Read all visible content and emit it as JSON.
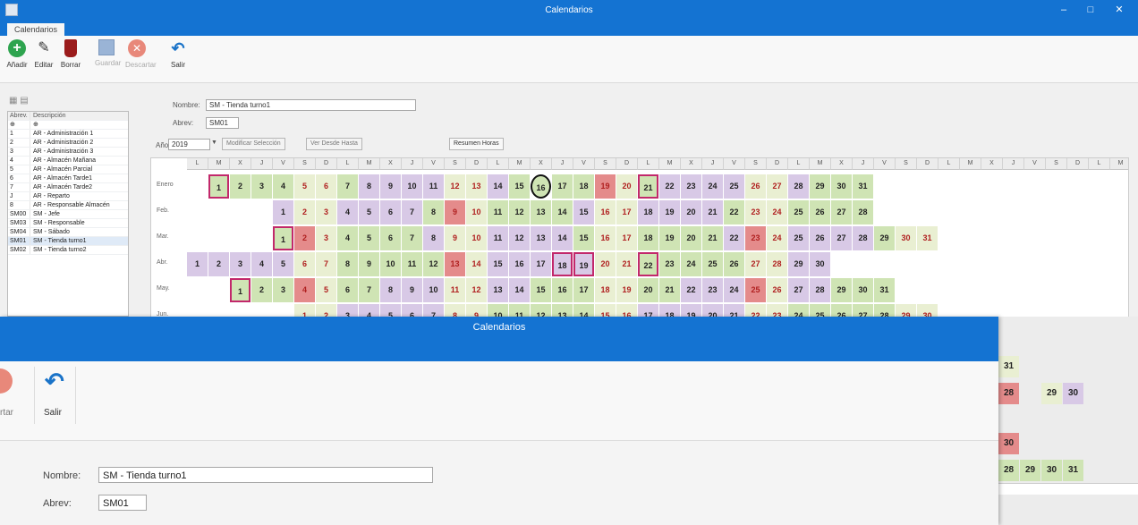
{
  "window": {
    "title": "Calendarios"
  },
  "tabs": [
    {
      "label": "Calendarios"
    }
  ],
  "ribbon": {
    "buttons": [
      {
        "label": "Añadir",
        "icon": "add-icon",
        "enabled": true
      },
      {
        "label": "Editar",
        "icon": "edit-icon",
        "enabled": true
      },
      {
        "label": "Borrar",
        "icon": "delete-icon",
        "enabled": true
      },
      {
        "label": "Guardar",
        "icon": "save-icon",
        "enabled": false
      },
      {
        "label": "Descartar",
        "icon": "discard-icon",
        "enabled": false
      },
      {
        "label": "Salir",
        "icon": "exit-icon",
        "enabled": true
      }
    ]
  },
  "list": {
    "columns": [
      "Abrev.",
      "Descripción"
    ],
    "filter_row": [
      "⊕",
      "⊕"
    ],
    "rows": [
      {
        "code": "1",
        "desc": "AR - Administración 1"
      },
      {
        "code": "2",
        "desc": "AR - Administración 2"
      },
      {
        "code": "3",
        "desc": "AR - Administración 3"
      },
      {
        "code": "4",
        "desc": "AR - Almacén Mañana"
      },
      {
        "code": "5",
        "desc": "AR - Almacén Parcial"
      },
      {
        "code": "6",
        "desc": "AR - Almacén Tarde1"
      },
      {
        "code": "7",
        "desc": "AR - Almacén Tarde2"
      },
      {
        "code": "J",
        "desc": "AR - Reparto"
      },
      {
        "code": "8",
        "desc": "AR - Responsable Almacén"
      },
      {
        "code": "SM00",
        "desc": "SM - Jefe"
      },
      {
        "code": "SM03",
        "desc": "SM - Responsable"
      },
      {
        "code": "SM04",
        "desc": "SM - Sábado"
      },
      {
        "code": "SM01",
        "desc": "SM - Tienda turno1",
        "selected": true
      },
      {
        "code": "SM02",
        "desc": "SM - Tienda turno2"
      }
    ]
  },
  "form": {
    "nombre_label": "Nombre:",
    "nombre_value": "SM - Tienda turno1",
    "abrev_label": "Abrev:",
    "abrev_value": "SM01",
    "year_label": "Año",
    "year_value": "2019",
    "btn_modify": "Modificar Selección",
    "btn_view": "Ver Desde Hasta",
    "btn_summary": "Resumen Horas"
  },
  "calendar": {
    "weekday_letters": [
      "L",
      "M",
      "X",
      "J",
      "V",
      "S",
      "D"
    ],
    "months": [
      {
        "name": "Enero",
        "start": 1,
        "days": 31
      },
      {
        "name": "Feb.",
        "start": 4,
        "days": 28
      },
      {
        "name": "Mar.",
        "start": 4,
        "days": 31
      },
      {
        "name": "Abr.",
        "start": 0,
        "days": 30
      },
      {
        "name": "May.",
        "start": 2,
        "days": 31
      },
      {
        "name": "Jun.",
        "start": 5,
        "days": 30
      }
    ],
    "colors": {
      "green": "#cfe4b4",
      "lilac": "#d8c9e6",
      "red": "#e48b8b",
      "pale": "#e9efd2",
      "grey": "#dcdcdc"
    }
  },
  "overlay": {
    "title": "Calendarios",
    "buttons": [
      {
        "label": "rtar",
        "icon": "discard-icon"
      },
      {
        "label": "Salir",
        "icon": "exit-icon"
      }
    ],
    "nombre_label": "Nombre:",
    "nombre_value": "SM - Tienda turno1",
    "abrev_label": "Abrev:",
    "abrev_value": "SM01"
  },
  "peek_days": [
    "31",
    "28",
    "29",
    "30",
    "30",
    "28",
    "29",
    "30",
    "31"
  ]
}
